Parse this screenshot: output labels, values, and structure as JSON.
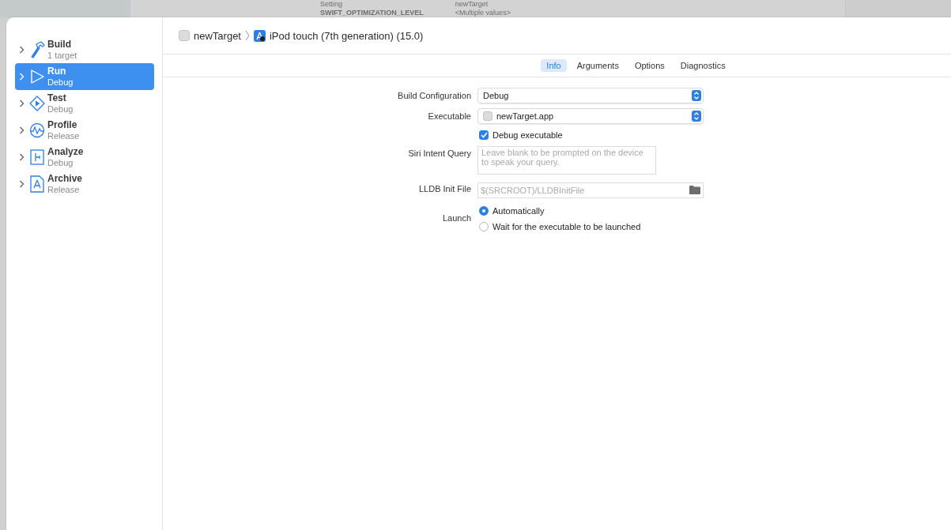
{
  "backdrop": {
    "header": "Setting",
    "setting": "SWIFT_OPTIMIZATION_LEVEL",
    "target": "newTarget",
    "value": "<Multiple values>"
  },
  "sidebar": {
    "items": [
      {
        "kind": "build",
        "title": "Build",
        "subtitle": "1 target",
        "selected": false
      },
      {
        "kind": "run",
        "title": "Run",
        "subtitle": "Debug",
        "selected": true
      },
      {
        "kind": "test",
        "title": "Test",
        "subtitle": "Debug",
        "selected": false
      },
      {
        "kind": "profile",
        "title": "Profile",
        "subtitle": "Release",
        "selected": false
      },
      {
        "kind": "analyze",
        "title": "Analyze",
        "subtitle": "Debug",
        "selected": false
      },
      {
        "kind": "archive",
        "title": "Archive",
        "subtitle": "Release",
        "selected": false
      }
    ]
  },
  "breadcrumb": {
    "target": "newTarget",
    "device": "iPod touch (7th generation) (15.0)"
  },
  "tabs": [
    {
      "label": "Info",
      "selected": true
    },
    {
      "label": "Arguments",
      "selected": false
    },
    {
      "label": "Options",
      "selected": false
    },
    {
      "label": "Diagnostics",
      "selected": false
    }
  ],
  "form": {
    "build_configuration": {
      "label": "Build Configuration",
      "value": "Debug"
    },
    "executable": {
      "label": "Executable",
      "value": "newTarget.app"
    },
    "debug_executable": {
      "label": "Debug executable",
      "checked": true
    },
    "siri_intent_query": {
      "label": "Siri Intent Query",
      "placeholder": "Leave blank to be prompted on the device to speak your query."
    },
    "lldb_init_file": {
      "label": "LLDB Init File",
      "placeholder": "$(SRCROOT)/LLDBInitFile"
    },
    "launch": {
      "label": "Launch",
      "options": [
        {
          "label": "Automatically",
          "selected": true
        },
        {
          "label": "Wait for the executable to be launched",
          "selected": false
        }
      ]
    }
  }
}
